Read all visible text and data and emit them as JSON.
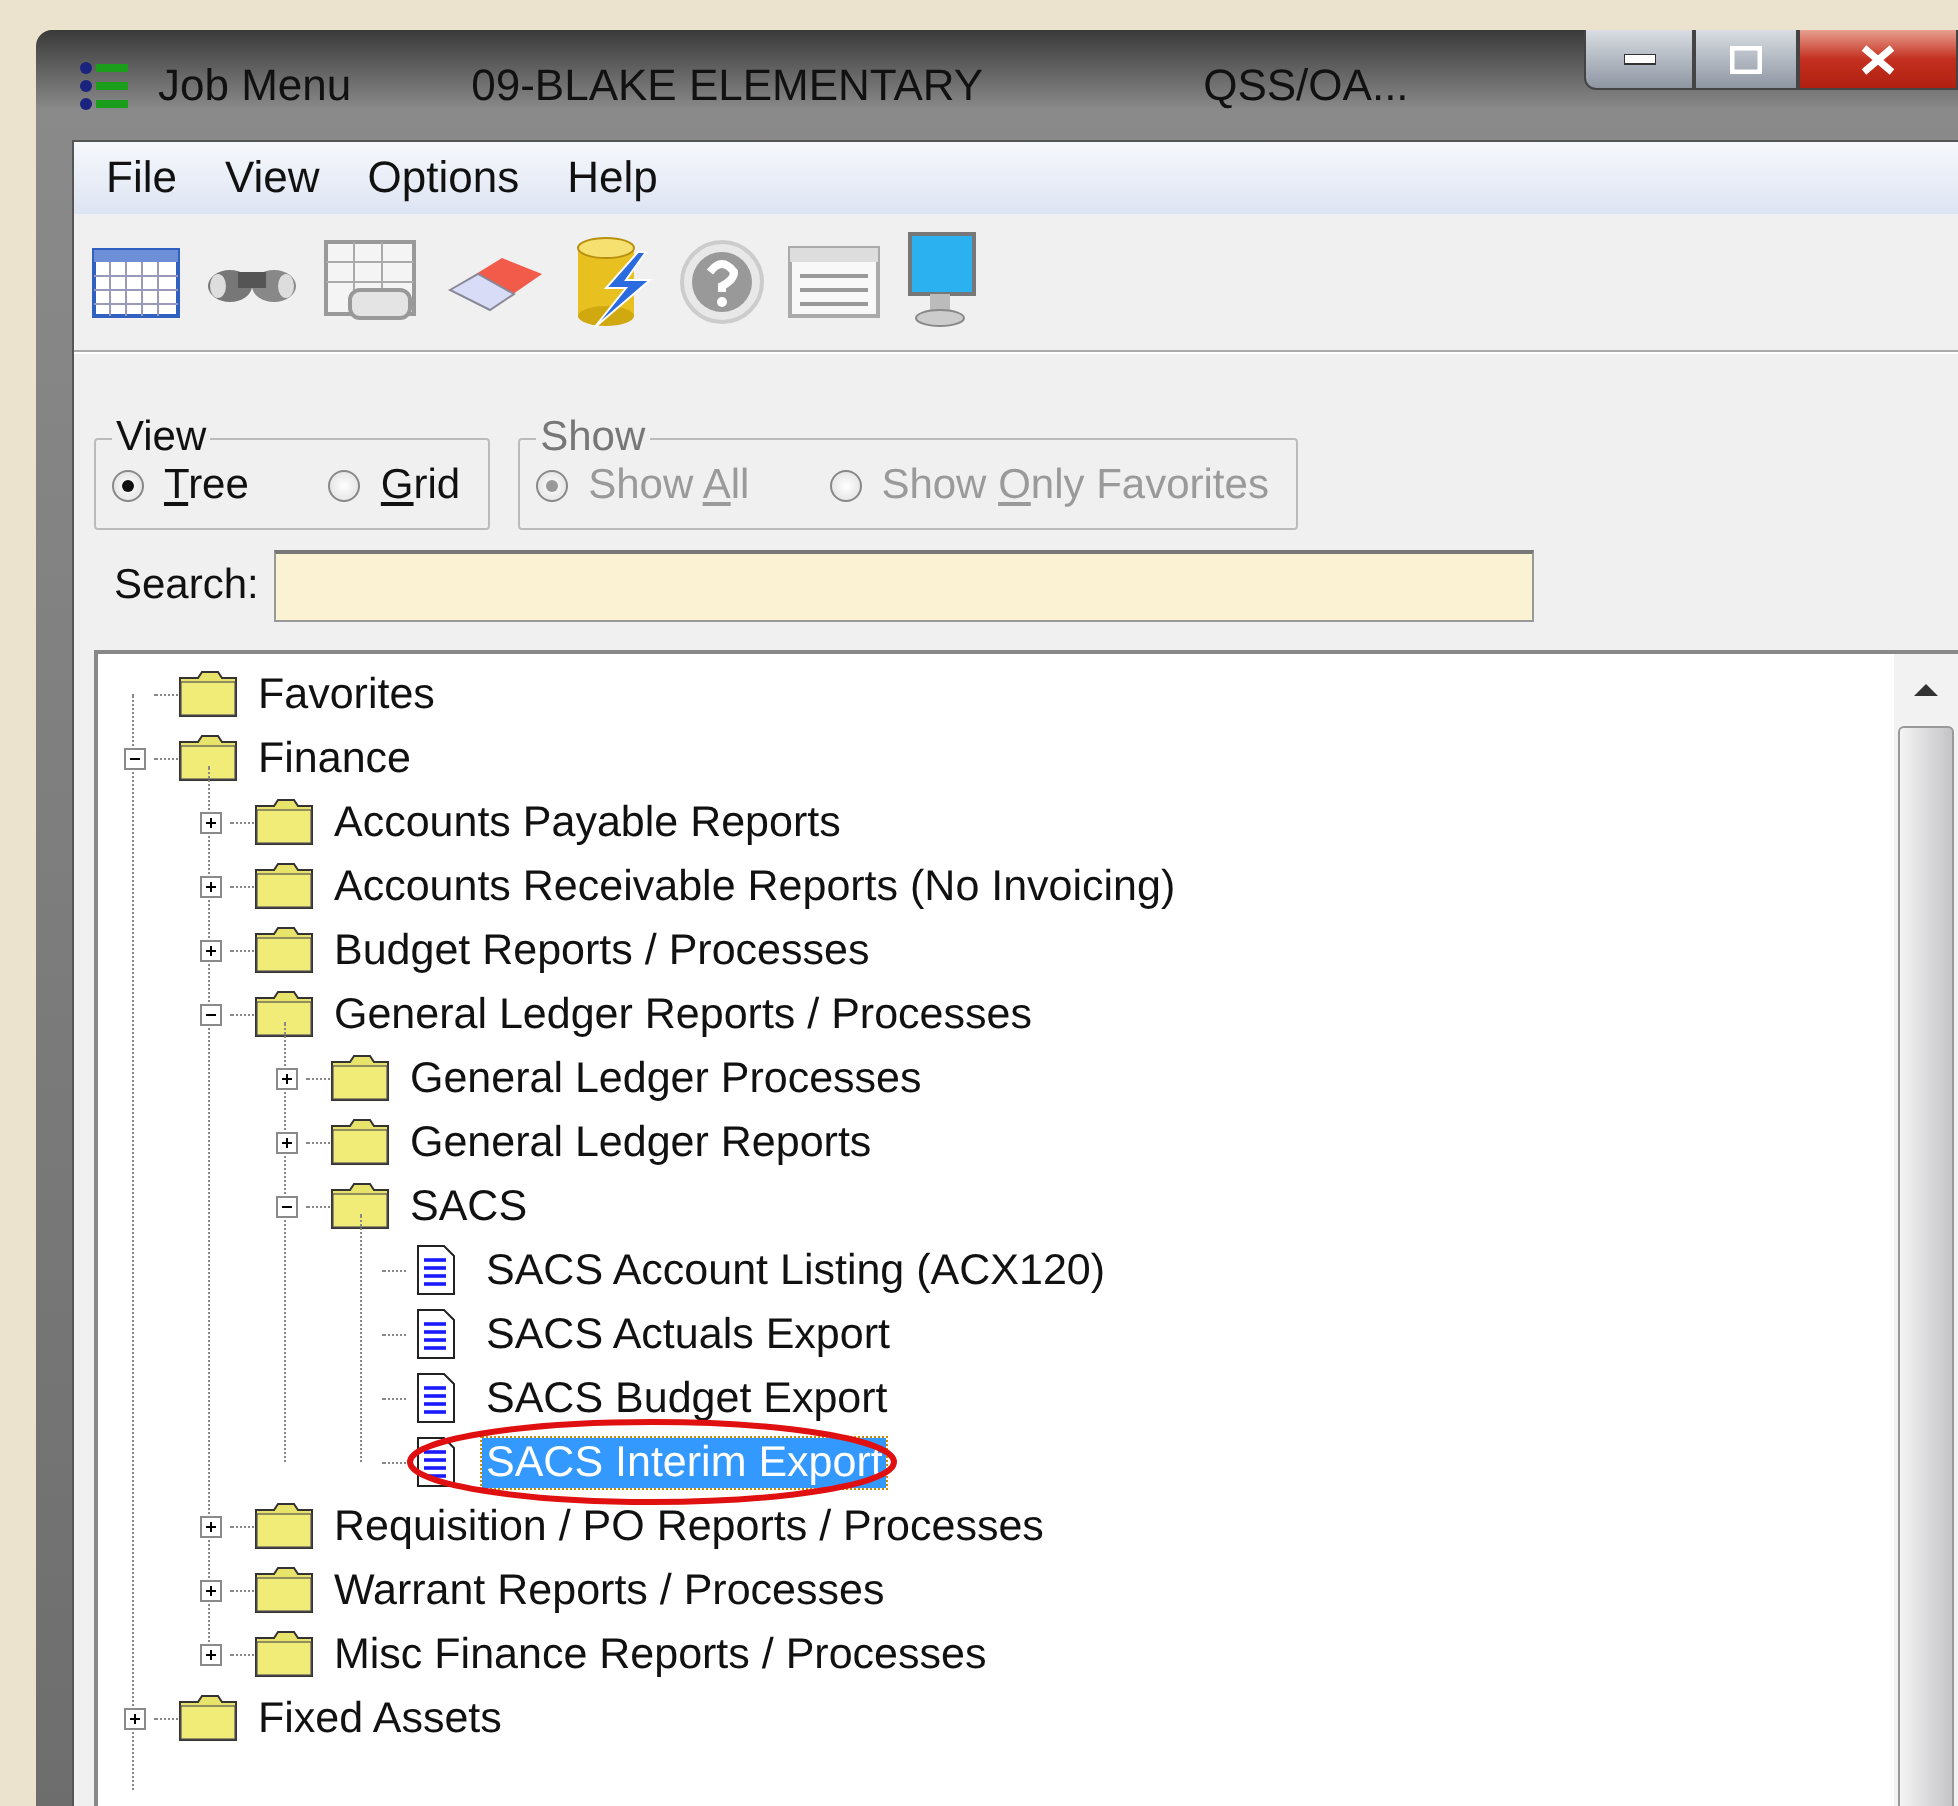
{
  "window": {
    "title": "Job Menu",
    "district": "09-BLAKE ELEMENTARY",
    "server": "QSS/OA..."
  },
  "menu": [
    "File",
    "View",
    "Options",
    "Help"
  ],
  "view_group": {
    "title": "View",
    "disabled": false,
    "options": [
      {
        "access_key": "T",
        "label_rest": "ree",
        "selected": true
      },
      {
        "access_key": "G",
        "label_rest": "rid",
        "selected": false
      }
    ]
  },
  "show_group": {
    "title": "Show",
    "disabled": true,
    "options": [
      {
        "label_start": "Show ",
        "access_key": "A",
        "label_rest": "ll",
        "selected": true
      },
      {
        "label_start": "Show ",
        "access_key": "O",
        "label_rest": "nly Favorites",
        "selected": false
      }
    ]
  },
  "search": {
    "label": "Search:"
  },
  "tree": [
    {
      "label": "Favorites",
      "kind": "empty_folder",
      "selected": false,
      "circled": false
    },
    {
      "label": "Finance",
      "kind": "folder",
      "expanded": true,
      "selected": false,
      "circled": false,
      "children": [
        {
          "label": "Accounts Payable Reports",
          "kind": "folder",
          "expanded": false,
          "selected": false,
          "circled": false
        },
        {
          "label": "Accounts Receivable Reports (No Invoicing)",
          "kind": "folder",
          "expanded": false,
          "selected": false,
          "circled": false
        },
        {
          "label": "Budget Reports / Processes",
          "kind": "folder",
          "expanded": false,
          "selected": false,
          "circled": false
        },
        {
          "label": "General Ledger Reports / Processes",
          "kind": "folder",
          "expanded": true,
          "selected": false,
          "circled": false,
          "children": [
            {
              "label": "General Ledger Processes",
              "kind": "folder",
              "expanded": false,
              "selected": false,
              "circled": false
            },
            {
              "label": "General Ledger Reports",
              "kind": "folder",
              "expanded": false,
              "selected": false,
              "circled": false
            },
            {
              "label": "SACS",
              "kind": "folder",
              "expanded": true,
              "selected": false,
              "circled": false,
              "children": [
                {
                  "label": "SACS Account Listing (ACX120)",
                  "kind": "document",
                  "selected": false,
                  "circled": false
                },
                {
                  "label": "SACS Actuals Export",
                  "kind": "document",
                  "selected": false,
                  "circled": false
                },
                {
                  "label": "SACS Budget Export",
                  "kind": "document",
                  "selected": false,
                  "circled": false
                },
                {
                  "label": "SACS Interim Export",
                  "kind": "document",
                  "selected": true,
                  "circled": true
                }
              ]
            }
          ]
        },
        {
          "label": "Requisition / PO Reports / Processes",
          "kind": "folder",
          "expanded": false,
          "selected": false,
          "circled": false
        },
        {
          "label": "Warrant Reports / Processes",
          "kind": "folder",
          "expanded": false,
          "selected": false,
          "circled": false
        },
        {
          "label": "Misc Finance Reports / Processes",
          "kind": "folder",
          "expanded": false,
          "selected": false,
          "circled": false
        }
      ]
    },
    {
      "label": "Fixed Assets",
      "kind": "folder",
      "expanded": false,
      "selected": false,
      "circled": false
    }
  ]
}
